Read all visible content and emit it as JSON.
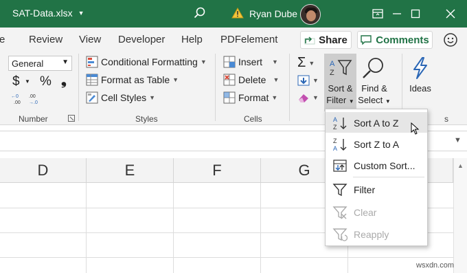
{
  "titlebar": {
    "filename": "SAT-Data.xlsx",
    "user_name": "Ryan Dube",
    "bg_color": "#217346",
    "icons": [
      "search-icon",
      "warning-icon",
      "ribbon-display-icon",
      "minimize-icon",
      "maximize-icon",
      "close-icon"
    ]
  },
  "tabs": {
    "items": [
      "Review",
      "View",
      "Developer",
      "Help",
      "PDFelement"
    ],
    "share_label": "Share",
    "comments_label": "Comments"
  },
  "ribbon": {
    "number": {
      "format_value": "General",
      "currency": "$",
      "percent": "%",
      "comma": "❟",
      "group_label": "Number"
    },
    "styles": {
      "conditional_formatting": "Conditional Formatting",
      "format_as_table": "Format as Table",
      "cell_styles": "Cell Styles",
      "group_label": "Styles"
    },
    "cells": {
      "insert": "Insert",
      "delete": "Delete",
      "format": "Format",
      "group_label": "Cells"
    },
    "editing": {
      "sort_filter_line1": "Sort &",
      "sort_filter_line2": "Filter",
      "find_select_line1": "Find &",
      "find_select_line2": "Select",
      "ideas": "Ideas",
      "group_label_tail": "s"
    }
  },
  "grid": {
    "columns": [
      "D",
      "E",
      "F",
      "G"
    ]
  },
  "sort_menu": {
    "items": [
      {
        "label": "Sort A to Z",
        "icon": "sort-a-to-z-icon",
        "state": "hover"
      },
      {
        "label": "Sort Z to A",
        "icon": "sort-z-to-a-icon",
        "state": "normal"
      },
      {
        "label": "Custom Sort...",
        "icon": "custom-sort-icon",
        "state": "normal"
      },
      {
        "label": "Filter",
        "icon": "filter-icon",
        "state": "normal"
      },
      {
        "label": "Clear",
        "icon": "clear-filter-icon",
        "state": "disabled"
      },
      {
        "label": "Reapply",
        "icon": "reapply-icon",
        "state": "disabled"
      }
    ]
  },
  "watermark": "wsxdn.com"
}
